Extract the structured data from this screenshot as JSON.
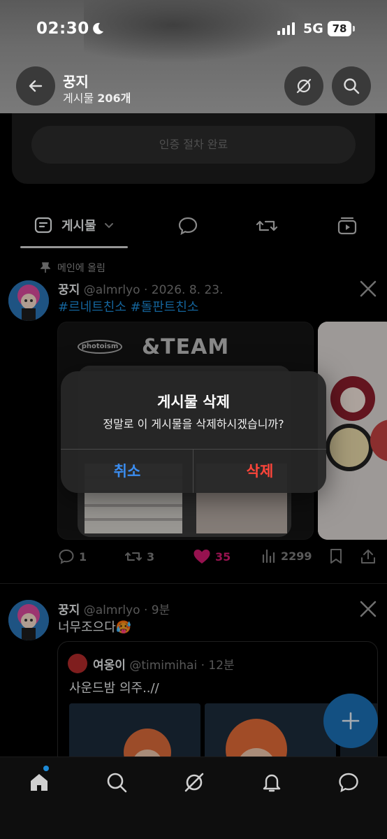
{
  "status_bar": {
    "time": "02:30",
    "network": "5G",
    "battery": "78",
    "icons": [
      "moon-icon",
      "signal-icon",
      "battery-icon"
    ]
  },
  "header": {
    "profile_name": "꿍지",
    "post_count_prefix": "게시물",
    "post_count_value": "206개",
    "icons": [
      "back-arrow-icon",
      "grok-icon",
      "search-icon"
    ]
  },
  "verify_card": {
    "button_label": "인증 절차 완료"
  },
  "tabs": {
    "posts_label": "게시물",
    "icons": [
      "posts-icon",
      "chevron-down-icon",
      "replies-icon",
      "reposts-icon",
      "media-icon"
    ]
  },
  "pinned_post": {
    "pin_label": "메인에 올림",
    "name": "꿍지",
    "handle_date": "@almrlyo · 2026. 8. 23.",
    "hashtags": "#르네트친소 #돌판트친소",
    "media_logo_left": "photoism",
    "media_logo_right": "&TEAM",
    "stats": {
      "replies": "1",
      "reposts": "3",
      "likes": "35",
      "views": "2299"
    }
  },
  "second_post": {
    "name": "꿍지",
    "handle_time": "@almrlyo · 9분",
    "text": "너무조으다🥵",
    "quote": {
      "name": "여옹이",
      "handle_time": "@timimihai · 12분",
      "text": "사운드밤 의주..//"
    }
  },
  "dialog": {
    "title": "게시물 삭제",
    "message": "정말로 이 게시물을 삭제하시겠습니까?",
    "cancel_label": "취소",
    "delete_label": "삭제"
  },
  "bottom_nav": {
    "icons": [
      "home-icon",
      "search-icon",
      "grok-icon",
      "notifications-icon",
      "messages-icon"
    ]
  },
  "colors": {
    "accent_blue": "#1d8ad6",
    "like_pink": "#d01a6e",
    "cancel_blue": "#3b8df0",
    "delete_red": "#ff453a"
  }
}
